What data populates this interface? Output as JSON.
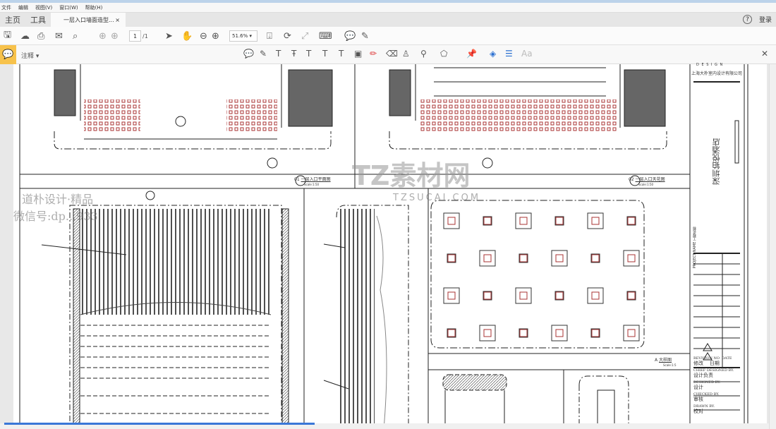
{
  "menu": [
    "文件",
    "编辑",
    "视图(V)",
    "窗口(W)",
    "帮助(H)"
  ],
  "tabs": {
    "home": "主页",
    "tools": "工具",
    "document": "一层入口墙面造型...",
    "close": "×",
    "help": "?",
    "login": "登录"
  },
  "toolbar": {
    "page_current": "1",
    "page_total": "/1",
    "zoom": "51.6%"
  },
  "comment": {
    "label": "注释 ▾",
    "close": "✕",
    "text_size": "Aa"
  },
  "drawing": {
    "company_en": "D E S I G N",
    "company": "上海大朴室内设计有限公司",
    "project": "深圳铂悦酒店",
    "project_name_label": "PROJECT NAME",
    "project_name_cn": "工程名称",
    "title1": "一层入口平面图",
    "scale1": "Scale:1:50",
    "num1": "01",
    "title2": "一层入口天花图",
    "scale2": "Scale:1:50",
    "num2": "02",
    "title3": "大样图",
    "scale3": "Scale:1:5",
    "num3": "A",
    "rev_en": "REVISION NO",
    "rev_cn": "修改",
    "date_en": "DATE",
    "date_cn": "日期",
    "chief_en": "CHIEF DESIGNED BY.",
    "chief_cn": "设计负责",
    "designed_en": "DESIGNED BY.",
    "designed_cn": "设计",
    "checked_en": "CHECKED BY.",
    "checked_cn": "审核",
    "drawn_en": "DRAWN BY.",
    "drawn_cn": "校对"
  },
  "watermark": {
    "site": "TZ素材网",
    "domain": "TZSUCAI.COM",
    "studio": "道朴设计·精品",
    "wechat": "微信号:dp...933"
  }
}
